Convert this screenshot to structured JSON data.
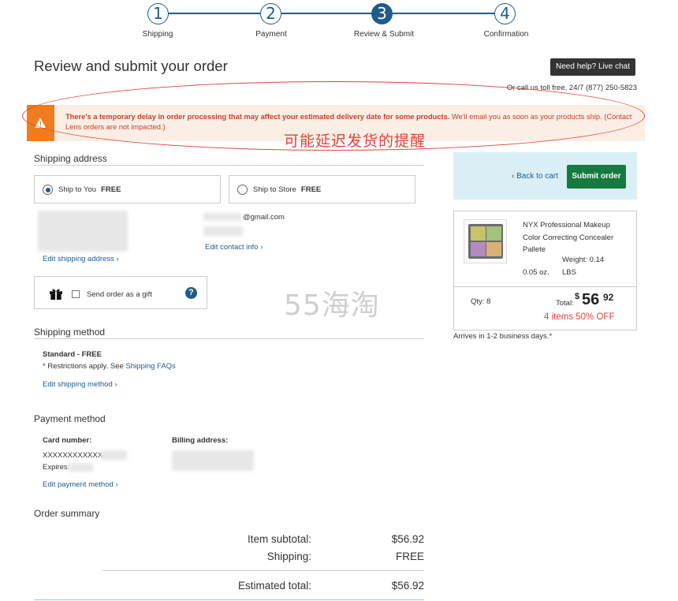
{
  "steps": [
    {
      "number": "1",
      "label": "Shipping"
    },
    {
      "number": "2",
      "label": "Payment"
    },
    {
      "number": "3",
      "label": "Review & Submit"
    },
    {
      "number": "4",
      "label": "Confirmation"
    }
  ],
  "header": {
    "title": "Review and submit your order",
    "help_button": "Need help? Live chat",
    "call_text": "Or call us toll free, 24/7 (877) 250-5823"
  },
  "alert": {
    "bold_text": "There's a temporary delay in order processing that may affect your estimated delivery date for some products.",
    "text": " We'll email you as soon as your products ship. (Contact Lens orders are not impacted.)",
    "annotation": "可能延迟发货的提醒"
  },
  "shipping_address": {
    "title": "Shipping address",
    "option_ship_to_you": "Ship to You",
    "option_ship_to_you_price": "FREE",
    "option_ship_to_store": "Ship to Store",
    "option_ship_to_store_price": "FREE",
    "email_suffix": "@gmail.com",
    "edit_shipping": "Edit shipping address ›",
    "edit_contact": "Edit contact info ›"
  },
  "gift": {
    "label": "Send order as a gift",
    "help": "?"
  },
  "watermark": "55海淘",
  "shipping_method": {
    "title": "Shipping method",
    "method": "Standard - FREE",
    "restrictions_prefix": "* Restrictions apply. See ",
    "faq_link": "Shipping FAQs",
    "edit": "Edit shipping method ›"
  },
  "payment_method": {
    "title": "Payment method",
    "card_label": "Card number:",
    "card_value": "XXXXXXXXXXXX",
    "expires_label": "Expires:",
    "billing_label": "Billing address:",
    "edit": "Edit payment method ›"
  },
  "order_summary": {
    "title": "Order summary",
    "subtotal_label": "Item subtotal:",
    "subtotal_value": "$56.92",
    "shipping_label": "Shipping:",
    "shipping_value": "FREE",
    "total_label": "Estimated total:",
    "total_value": "$56.92"
  },
  "cart": {
    "back_link": "‹ Back to cart",
    "submit": "Submit order"
  },
  "product": {
    "name": "NYX Professional Makeup Color Correcting Concealer Pallete",
    "weight": "Weight: 0.14",
    "oz": "0.05 oz.",
    "lbs": "LBS",
    "qty": "Qty: 8",
    "total_label": "Total:",
    "price_dollar": "$",
    "price_main": "56",
    "price_cents": "92",
    "promo": "4 items 50% OFF",
    "arrives": "Arrives in 1-2 business days.*"
  },
  "colors": {
    "brand_blue": "#1f5b8c",
    "submit_green": "#147a3d",
    "alert_orange": "#f07c1e",
    "alert_text": "#c7402a",
    "promo_red": "#e0433b"
  }
}
